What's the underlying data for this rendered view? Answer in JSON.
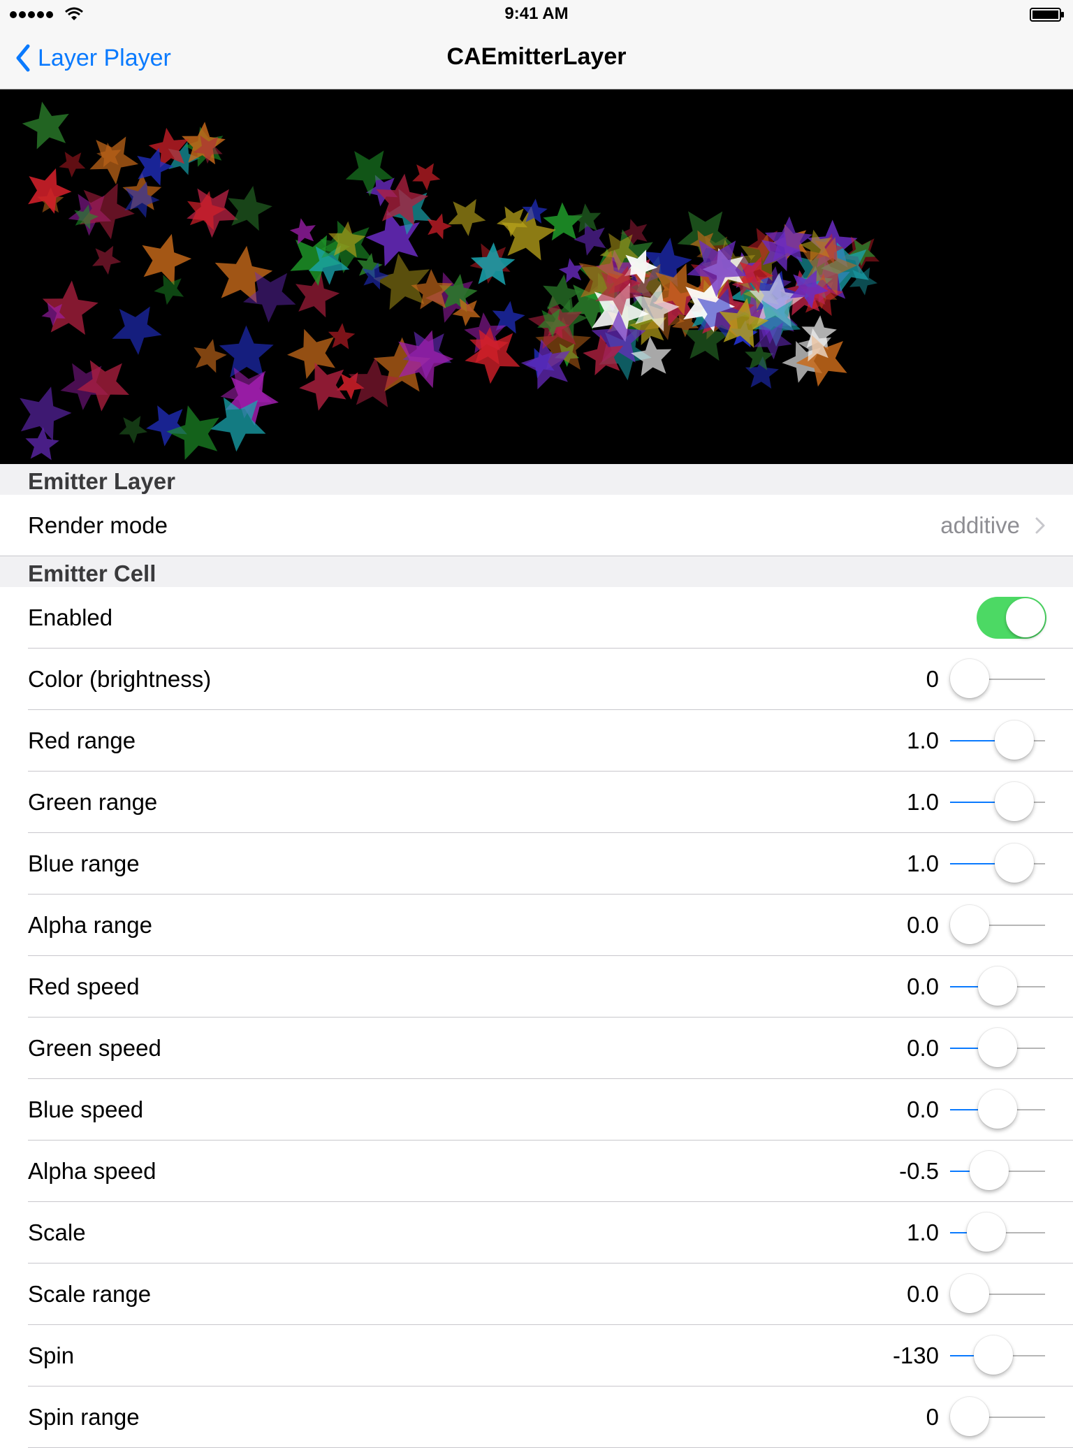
{
  "status_bar": {
    "time": "9:41 AM"
  },
  "nav": {
    "back_label": "Layer Player",
    "title": "CAEmitterLayer"
  },
  "sections": {
    "emitter_layer": {
      "title": "Emitter Layer",
      "render_mode_label": "Render mode",
      "render_mode_value": "additive"
    },
    "emitter_cell": {
      "title": "Emitter Cell",
      "enabled_label": "Enabled",
      "enabled": true,
      "sliders": [
        {
          "label": "Color (brightness)",
          "value": "0",
          "level": 0.0
        },
        {
          "label": "Red range",
          "value": "1.0",
          "level": 0.8
        },
        {
          "label": "Green range",
          "value": "1.0",
          "level": 0.8
        },
        {
          "label": "Blue range",
          "value": "1.0",
          "level": 0.8
        },
        {
          "label": "Alpha range",
          "value": "0.0",
          "level": 0.0
        },
        {
          "label": "Red speed",
          "value": "0.0",
          "level": 0.5
        },
        {
          "label": "Green speed",
          "value": "0.0",
          "level": 0.5
        },
        {
          "label": "Blue speed",
          "value": "0.0",
          "level": 0.5
        },
        {
          "label": "Alpha speed",
          "value": "-0.5",
          "level": 0.35
        },
        {
          "label": "Scale",
          "value": "1.0",
          "level": 0.3
        },
        {
          "label": "Scale range",
          "value": "0.0",
          "level": 0.0
        },
        {
          "label": "Spin",
          "value": "-130",
          "level": 0.43
        },
        {
          "label": "Spin range",
          "value": "0",
          "level": 0.0
        }
      ]
    }
  },
  "colors": {
    "accent": "#0a7afe",
    "toggle_on": "#4cd964",
    "detail_text": "#8e8e93"
  },
  "icons": {
    "back": "chevron-left-icon",
    "disclosure": "chevron-right-icon",
    "particle": "star-icon"
  }
}
